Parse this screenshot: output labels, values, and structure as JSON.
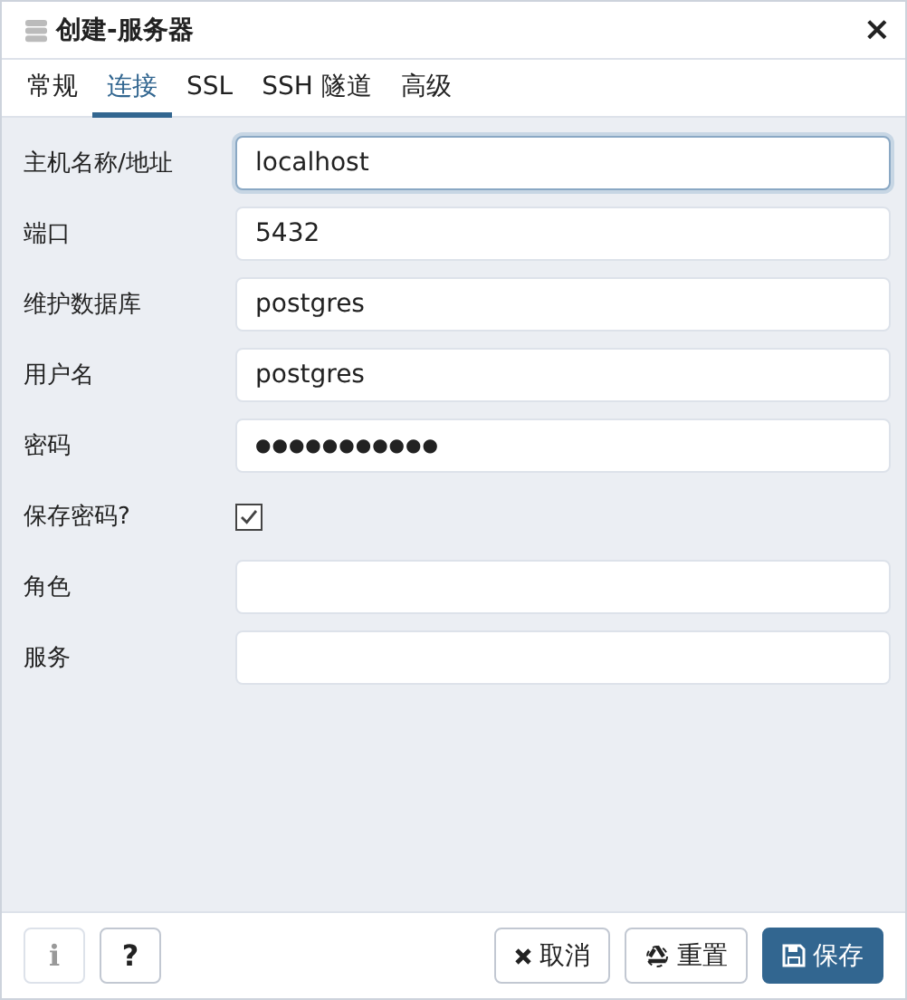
{
  "window": {
    "title": "创建-服务器",
    "close": "×"
  },
  "tabs": [
    {
      "label": "常规",
      "selected": false
    },
    {
      "label": "连接",
      "selected": true
    },
    {
      "label": "SSL",
      "selected": false
    },
    {
      "label": "SSH 隧道",
      "selected": false
    },
    {
      "label": "高级",
      "selected": false
    }
  ],
  "fields": [
    {
      "kind": "text",
      "label": "主机名称/地址",
      "value": "localhost",
      "focused": true
    },
    {
      "kind": "text",
      "label": "端口",
      "value": "5432",
      "focused": false
    },
    {
      "kind": "text",
      "label": "维护数据库",
      "value": "postgres",
      "focused": false
    },
    {
      "kind": "text",
      "label": "用户名",
      "value": "postgres",
      "focused": false
    },
    {
      "kind": "password",
      "label": "密码",
      "value": "●●●●●●●●●●●",
      "focused": false
    },
    {
      "kind": "checkbox",
      "label": "保存密码?",
      "checked": true
    },
    {
      "kind": "text",
      "label": "角色",
      "focused": false
    },
    {
      "kind": "text",
      "label": "服务",
      "focused": false
    }
  ],
  "footer": {
    "left": [
      {
        "kind": "info",
        "label": "i",
        "disabled": true
      },
      {
        "kind": "help",
        "label": "?",
        "disabled": false
      }
    ],
    "right": [
      {
        "kind": "cancel",
        "label": "取消"
      },
      {
        "kind": "reset",
        "label": "重置"
      },
      {
        "kind": "save",
        "label": "保存"
      }
    ]
  }
}
